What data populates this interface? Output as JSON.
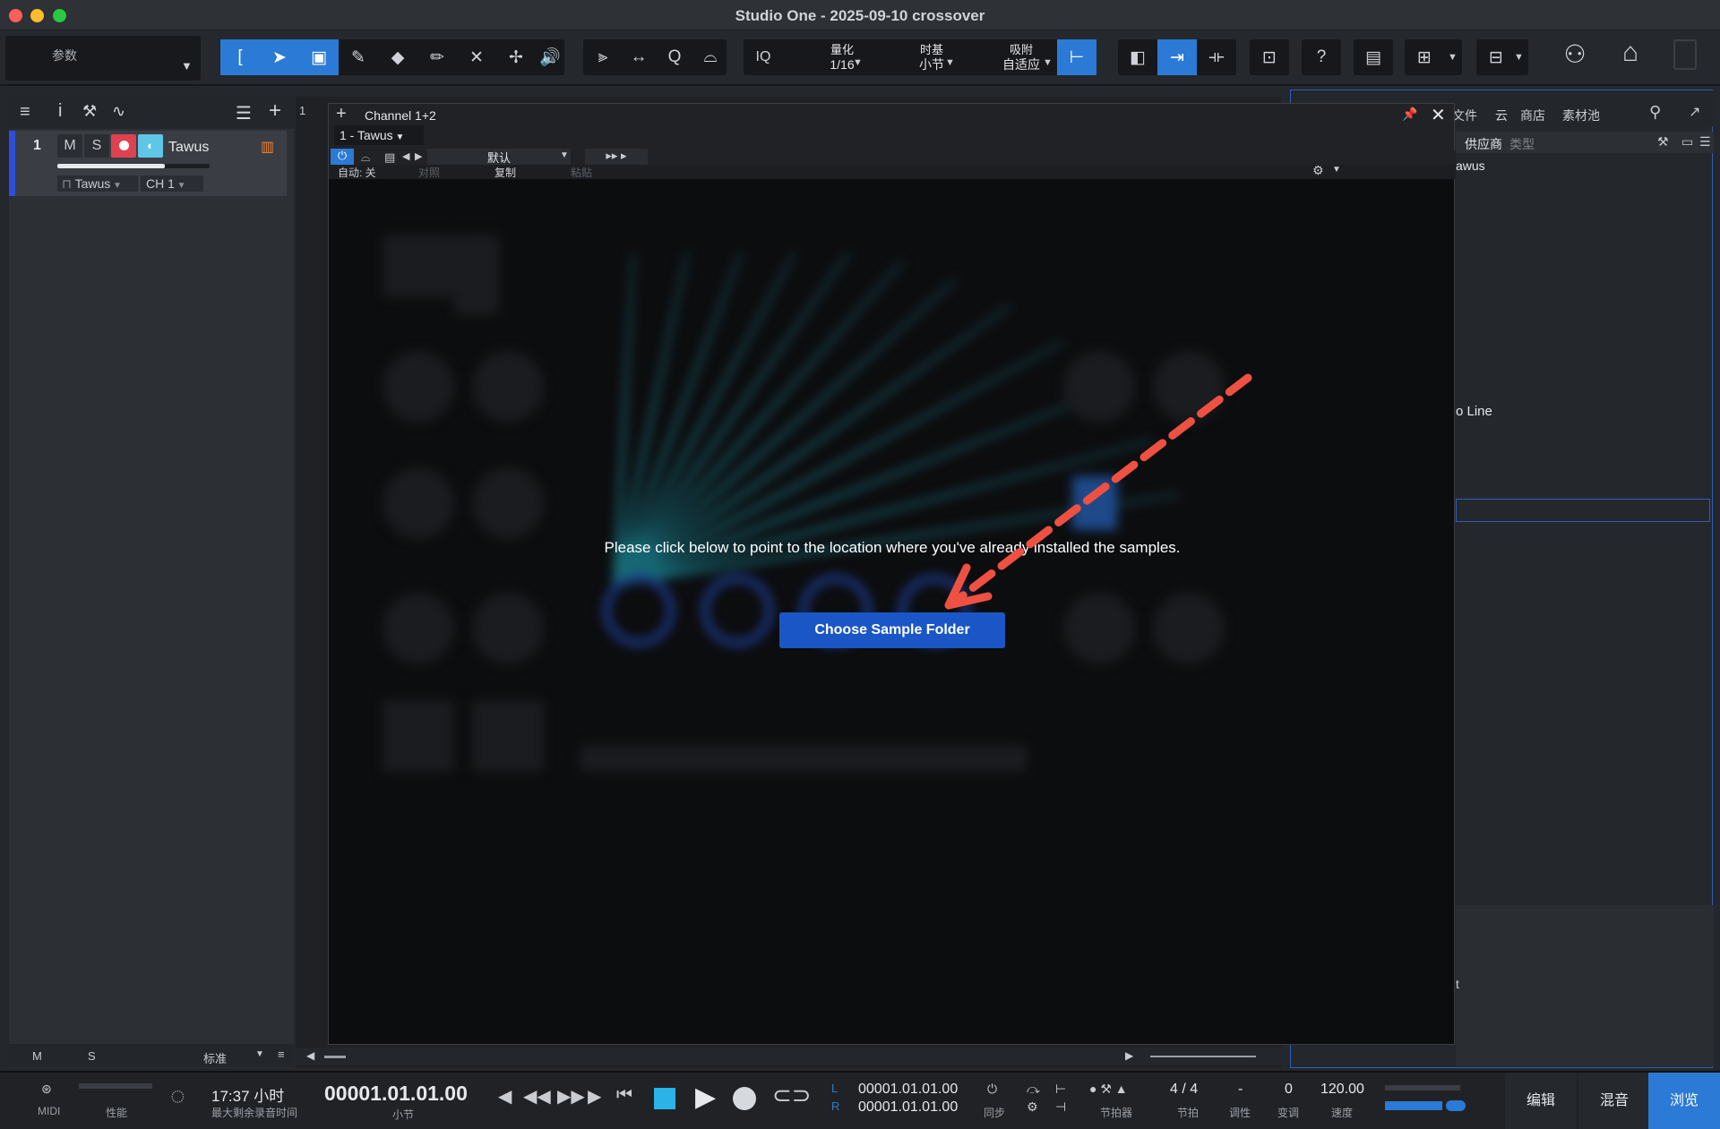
{
  "window": {
    "title": "Studio One - 2025-09-10 crossover"
  },
  "toolbar": {
    "params_label": "参数",
    "iq_label": "IQ",
    "quantize": {
      "label": "量化",
      "value": "1/16"
    },
    "timebase": {
      "label": "时基",
      "value": "小节"
    },
    "snap": {
      "label": "吸附",
      "value": "自适应"
    },
    "help_label": "?"
  },
  "track": {
    "number": "1",
    "mute": "M",
    "solo": "S",
    "name": "Tawus",
    "instrument": "Tawus",
    "channel": "CH 1",
    "ruler_mark": "1"
  },
  "left_bottom": {
    "m": "M",
    "s": "S",
    "mode": "标准"
  },
  "plugin": {
    "title": "Channel 1+2",
    "instance": "1 - Tawus",
    "preset": "默认",
    "auto": "自动: 关",
    "compare": "对照",
    "copy": "复制",
    "paste": "粘贴",
    "message": "Please click below to point to the location where you've already installed the samples.",
    "button": "Choose Sample Folder"
  },
  "browser": {
    "tabs": [
      "文件",
      "云",
      "商店",
      "素材池"
    ],
    "subtabs": [
      "供应商",
      "类型"
    ],
    "item1": "awus",
    "item2": "o Line",
    "item3": "t"
  },
  "transport": {
    "midi": "MIDI",
    "perf": "性能",
    "record_time": "17:37 小时",
    "record_time_label": "最大剩余录音时间",
    "position": "00001.01.01.00",
    "position_unit": "小节",
    "loop_l": "00001.01.01.00",
    "loop_r": "00001.01.01.00",
    "L": "L",
    "R": "R",
    "sync": "同步",
    "metronome": "节拍器",
    "signature": "4 / 4",
    "signature_label": "节拍",
    "key": "-",
    "key_label": "调性",
    "transpose": "0",
    "transpose_label": "变调",
    "tempo": "120.00",
    "tempo_label": "速度",
    "edit": "编辑",
    "mix": "混音",
    "browse": "浏览"
  },
  "colors": {
    "accent": "#2a7ad6",
    "record": "#e0414f",
    "monitor": "#5fc6e8",
    "button": "#1a56c6",
    "arrow": "#ee5142"
  }
}
